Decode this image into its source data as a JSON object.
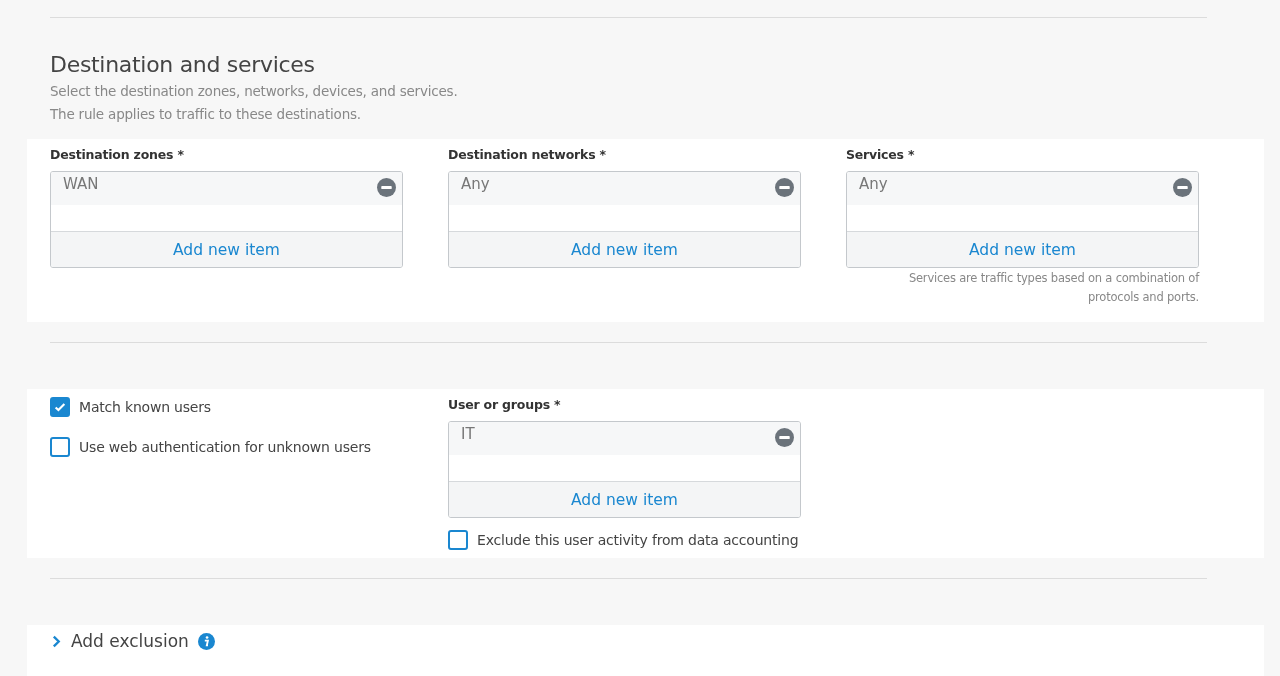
{
  "destination": {
    "title": "Destination and services",
    "descriptions": [
      "Select the destination zones, networks, devices, and services.",
      "The rule applies to traffic to these destinations."
    ],
    "fields": [
      {
        "label": "Destination zones *",
        "items": [
          "WAN"
        ],
        "add_label": "Add new item"
      },
      {
        "label": "Destination networks *",
        "items": [
          "Any"
        ],
        "add_label": "Add new item"
      },
      {
        "label": "Services *",
        "items": [
          "Any"
        ],
        "add_label": "Add new item",
        "note": "Services are traffic types based on a combination of protocols and ports."
      }
    ]
  },
  "users": {
    "options": [
      {
        "label": "Match known users",
        "checked": true
      },
      {
        "label": "Use web authentication for unknown users",
        "checked": false
      }
    ],
    "field": {
      "label": "User or groups *",
      "items": [
        "IT"
      ],
      "add_label": "Add new item"
    },
    "exclude": {
      "label": "Exclude this user activity from data accounting",
      "checked": false
    }
  },
  "exclusion": {
    "label": "Add exclusion",
    "expanded": false
  }
}
